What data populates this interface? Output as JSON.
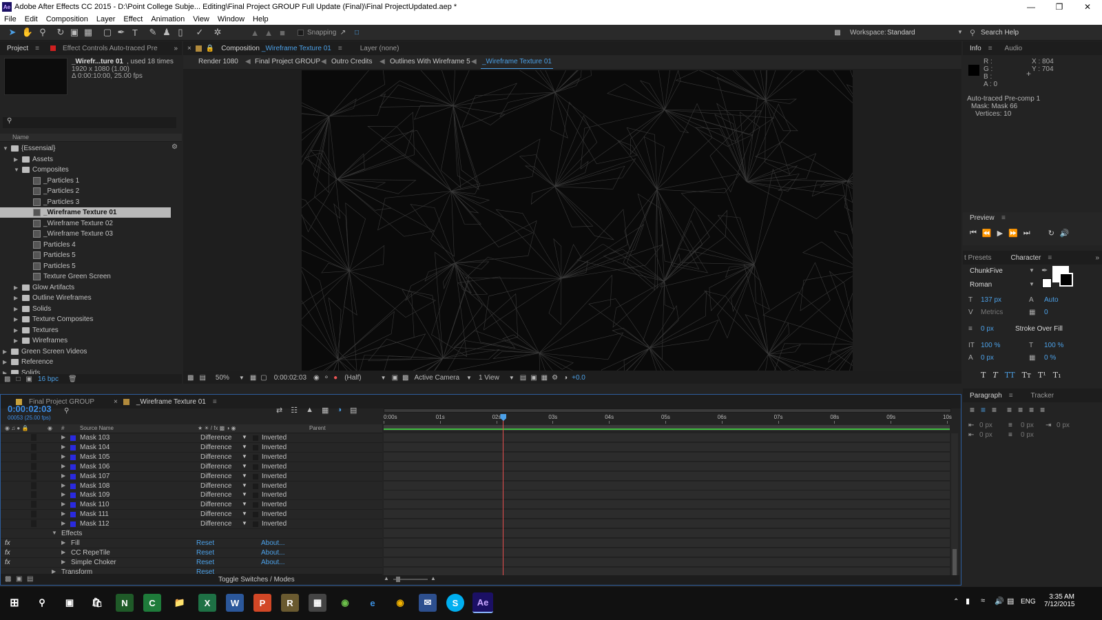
{
  "window": {
    "title": "Adobe After Effects CC 2015 - D:\\Point College Subje... Editing\\Final Project GROUP Full Update (Final)\\Final ProjectUpdated.aep *",
    "app_icon_text": "Ae"
  },
  "menu": [
    "File",
    "Edit",
    "Composition",
    "Layer",
    "Effect",
    "Animation",
    "View",
    "Window",
    "Help"
  ],
  "toolbar": {
    "snapping_label": "Snapping",
    "workspace_label": "Workspace:",
    "workspace_value": "Standard",
    "search_help": "Search Help"
  },
  "project_panel": {
    "tab_project": "Project",
    "tab_effect_controls": "Effect Controls Auto-traced Pre",
    "item_name": "_Wirefr...ture 01",
    "item_used": ", used 18 times",
    "item_size": "1920 x 1080 (1.00)",
    "item_duration": "Δ 0:00:10:00, 25.00 fps",
    "search_icon": "search-icon",
    "column_name": "Name",
    "tree": [
      {
        "label": "{Essensial}",
        "type": "folder",
        "indent": 0,
        "open": true
      },
      {
        "label": "Assets",
        "type": "folder",
        "indent": 1,
        "open": false
      },
      {
        "label": "Composites",
        "type": "folder",
        "indent": 1,
        "open": true
      },
      {
        "label": "_Particles 1",
        "type": "comp",
        "indent": 2
      },
      {
        "label": "_Particles 2",
        "type": "comp",
        "indent": 2
      },
      {
        "label": "_Particles 3",
        "type": "comp",
        "indent": 2
      },
      {
        "label": "_Wireframe Texture 01",
        "type": "comp",
        "indent": 2,
        "selected": true
      },
      {
        "label": "_Wireframe Texture 02",
        "type": "comp",
        "indent": 2
      },
      {
        "label": "_Wireframe Texture 03",
        "type": "comp",
        "indent": 2
      },
      {
        "label": "Particles 4",
        "type": "comp",
        "indent": 2
      },
      {
        "label": "Particles 5",
        "type": "comp",
        "indent": 2
      },
      {
        "label": "Particles 5",
        "type": "comp",
        "indent": 2
      },
      {
        "label": "Texture  Green Screen",
        "type": "comp",
        "indent": 2
      },
      {
        "label": "Glow Artifacts",
        "type": "folder",
        "indent": 1,
        "open": false
      },
      {
        "label": "Outline Wireframes",
        "type": "folder",
        "indent": 1,
        "open": false
      },
      {
        "label": "Solids",
        "type": "folder",
        "indent": 1,
        "open": false
      },
      {
        "label": "Texture Composites",
        "type": "folder",
        "indent": 1,
        "open": false
      },
      {
        "label": "Textures",
        "type": "folder",
        "indent": 1,
        "open": false
      },
      {
        "label": "Wireframes",
        "type": "folder",
        "indent": 1,
        "open": false
      },
      {
        "label": "Green Screen Videos",
        "type": "folder",
        "indent": 0,
        "open": false
      },
      {
        "label": "Reference",
        "type": "folder",
        "indent": 0,
        "open": false
      },
      {
        "label": "Solids",
        "type": "folder",
        "indent": 0,
        "open": false
      }
    ],
    "bpc": "16 bpc"
  },
  "composition_panel": {
    "tab_label": "Composition",
    "tab_comp_name": "_Wireframe Texture 01",
    "layer_tab": "Layer (none)",
    "breadcrumbs": [
      "Render 1080",
      "Final Project GROUP",
      "Outro Credits",
      "Outlines With Wireframe 5",
      "_Wireframe Texture 01"
    ],
    "zoom": "50%",
    "timecode": "0:00:02:03",
    "resolution": "(Half)",
    "camera": "Active Camera",
    "views": "1 View",
    "exposure": "+0.0"
  },
  "info_panel": {
    "tab_info": "Info",
    "tab_audio": "Audio",
    "r": "R :",
    "g": "G :",
    "b": "B :",
    "a": "A : 0",
    "x": "X : 804",
    "y": "Y : 704",
    "line1": "Auto-traced Pre-comp 1",
    "line2": "Mask: Mask 66",
    "line3": "Vertices: 10"
  },
  "preview_panel": {
    "title": "Preview"
  },
  "character_panel": {
    "tab_presets": "t Presets",
    "tab_character": "Character",
    "font": "ChunkFive",
    "style": "Roman",
    "size": "137 px",
    "leading": "Auto",
    "kerning": "Metrics",
    "tracking": "0",
    "stroke_width": "0 px",
    "stroke_mode": "Stroke Over Fill",
    "vscale": "100 %",
    "hscale": "100 %",
    "baseline": "0 px",
    "tsume": "0 %"
  },
  "paragraph_panel": {
    "tab_paragraph": "Paragraph",
    "tab_tracker": "Tracker",
    "indent_left": "0 px",
    "space_before": "0 px",
    "indent_right": "0 px",
    "indent_first": "0 px",
    "space_after": "0 px"
  },
  "timeline": {
    "tab_1": "Final Project GROUP",
    "tab_2": "_Wireframe Texture 01",
    "timecode": "0:00:02:03",
    "frame_info": "00053 (25.00 fps)",
    "col_hash": "#",
    "col_source": "Source Name",
    "col_parent": "Parent",
    "ticks": [
      "0:00s",
      "01s",
      "02s",
      "03s",
      "04s",
      "05s",
      "06s",
      "07s",
      "08s",
      "09s",
      "10s"
    ],
    "masks": [
      {
        "name": "Mask 103",
        "mode": "Difference",
        "inv": "Inverted"
      },
      {
        "name": "Mask 104",
        "mode": "Difference",
        "inv": "Inverted"
      },
      {
        "name": "Mask 105",
        "mode": "Difference",
        "inv": "Inverted"
      },
      {
        "name": "Mask 106",
        "mode": "Difference",
        "inv": "Inverted"
      },
      {
        "name": "Mask 107",
        "mode": "Difference",
        "inv": "Inverted"
      },
      {
        "name": "Mask 108",
        "mode": "Difference",
        "inv": "Inverted"
      },
      {
        "name": "Mask 109",
        "mode": "Difference",
        "inv": "Inverted"
      },
      {
        "name": "Mask 110",
        "mode": "Difference",
        "inv": "Inverted"
      },
      {
        "name": "Mask 111",
        "mode": "Difference",
        "inv": "Inverted"
      },
      {
        "name": "Mask 112",
        "mode": "Difference",
        "inv": "Inverted"
      }
    ],
    "effects_label": "Effects",
    "effects": [
      {
        "name": "Fill",
        "reset": "Reset",
        "about": "About..."
      },
      {
        "name": "CC RepeTile",
        "reset": "Reset",
        "about": "About..."
      },
      {
        "name": "Simple Choker",
        "reset": "Reset",
        "about": "About..."
      }
    ],
    "transform_label": "Transform",
    "transform_reset": "Reset",
    "toggle_label": "Toggle Switches / Modes",
    "playhead_seconds": 2.12,
    "duration_seconds": 10
  },
  "taskbar": {
    "time": "3:35 AM",
    "date": "7/12/2015",
    "lang": "ENG"
  },
  "colors": {
    "accent_blue": "#4ca1e8",
    "timecode_blue": "#3d8ee6",
    "green_workarea": "#3fbf3f",
    "playhead_red": "#e85050"
  }
}
